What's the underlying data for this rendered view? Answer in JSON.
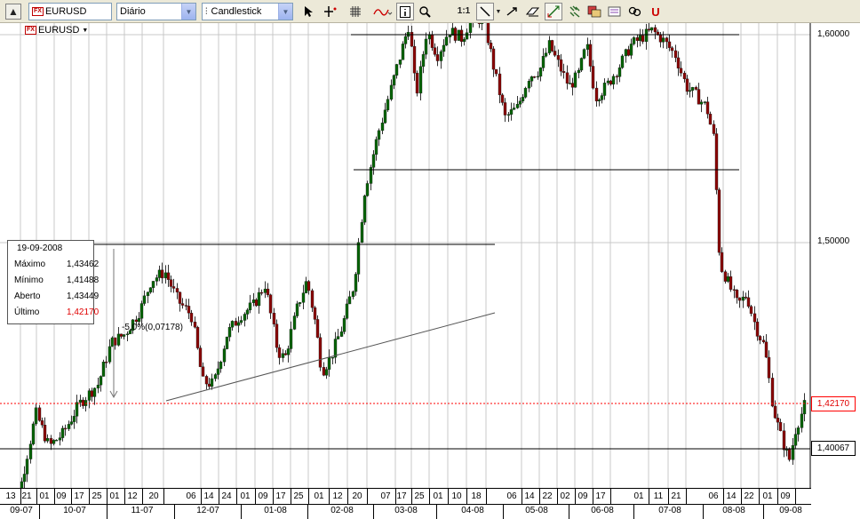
{
  "toolbar": {
    "symbol_value": "EURUSD",
    "symbol_badge": "FX",
    "period_value": "Diário",
    "chart_type_value": "Candlestick",
    "icons": [
      "scroll-up-icon",
      "pointer-icon",
      "crosshair-icon",
      "grid-icon",
      "indicator-icon",
      "info-icon",
      "zoom-icon",
      "one-to-one-icon",
      "trendline-tool-icon",
      "eraser-icon",
      "fibonacci-icon",
      "arrow-tool-icon",
      "pattern-icon",
      "objects-icon",
      "link-icon",
      "magnet-icon"
    ]
  },
  "chart": {
    "symbol": "EURUSD",
    "symbol_badge": "FX",
    "y_ticks": [
      "1,60000",
      "1,50000"
    ],
    "last_price_tag": "1,42170",
    "line_price_tag": "1,40067",
    "annotation": "-5,0%(0,07178)",
    "colors": {
      "up": "#006400",
      "down": "#8b0000",
      "last_line": "#ff0000",
      "grid": "#c8c8c8"
    }
  },
  "info_box": {
    "date": "19-09-2008",
    "rows": [
      {
        "label": "Máximo",
        "value": "1,43462"
      },
      {
        "label": "Mínimo",
        "value": "1,41488"
      },
      {
        "label": "Aberto",
        "value": "1,43449"
      },
      {
        "label": "Último",
        "value": "1,42170"
      }
    ]
  },
  "x_axis": {
    "days": [
      "13",
      "21",
      "01",
      "09",
      "17",
      "25",
      "01",
      "12",
      "20",
      "06",
      "14",
      "24",
      "01",
      "09",
      "17",
      "25",
      "01",
      "12",
      "20",
      "07",
      "17",
      "25",
      "01",
      "10",
      "18",
      "06",
      "14",
      "22",
      "02",
      "09",
      "17",
      "01",
      "11",
      "21",
      "06",
      "14",
      "22",
      "01",
      "09"
    ],
    "months": [
      "09-07",
      "10-07",
      "11-07",
      "12-07",
      "01-08",
      "02-08",
      "03-08",
      "04-08",
      "05-08",
      "06-08",
      "07-08",
      "08-08",
      "09-08"
    ]
  }
}
